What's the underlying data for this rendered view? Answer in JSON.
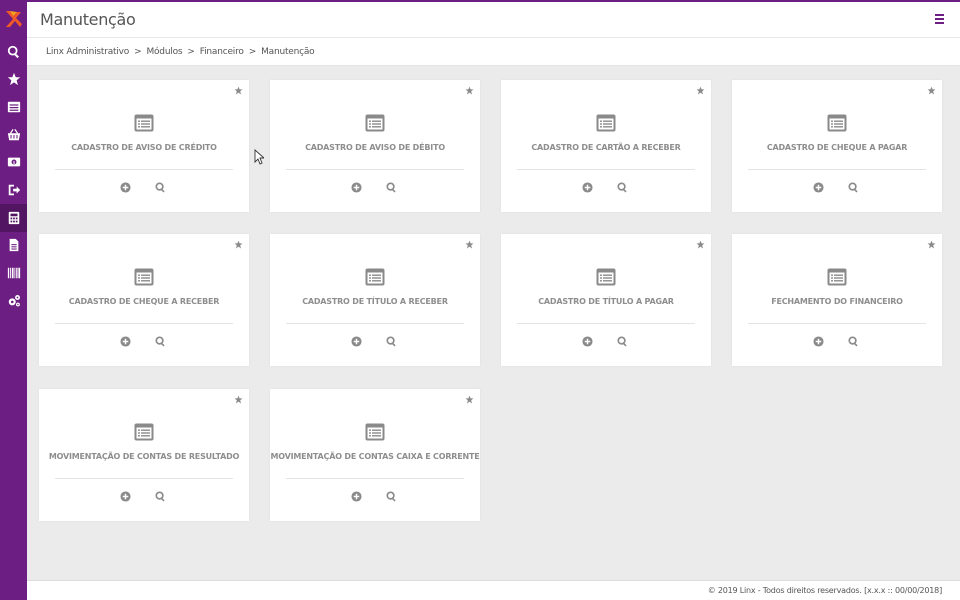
{
  "header": {
    "title": "Manutenção",
    "menu_icon": "hamburger-icon"
  },
  "breadcrumb": [
    {
      "label": "Linx Administrativo"
    },
    {
      "label": "Módulos"
    },
    {
      "label": "Financeiro"
    },
    {
      "label": "Manutenção"
    }
  ],
  "breadcrumb_separator": ">",
  "sidebar": {
    "logo": "linx-logo",
    "items": [
      {
        "icon": "search-icon"
      },
      {
        "icon": "star-icon"
      },
      {
        "icon": "list-icon"
      },
      {
        "icon": "basket-icon"
      },
      {
        "icon": "money-icon"
      },
      {
        "icon": "sign-out-icon"
      },
      {
        "icon": "calculator-icon",
        "active": true
      },
      {
        "icon": "document-icon"
      },
      {
        "icon": "barcode-icon"
      },
      {
        "icon": "gears-icon"
      }
    ]
  },
  "cards": [
    {
      "title": "CADASTRO DE AVISO DE CRÉDITO"
    },
    {
      "title": "CADASTRO DE AVISO DE DÉBITO"
    },
    {
      "title": "CADASTRO DE CARTÃO A RECEBER"
    },
    {
      "title": "CADASTRO DE CHEQUE A PAGAR"
    },
    {
      "title": "CADASTRO DE CHEQUE A RECEBER"
    },
    {
      "title": "CADASTRO DE TÍTULO A RECEBER"
    },
    {
      "title": "CADASTRO DE TÍTULO A PAGAR"
    },
    {
      "title": "FECHAMENTO DO FINANCEIRO"
    },
    {
      "title": "MOVIMENTAÇÃO DE CONTAS DE RESULTADO"
    },
    {
      "title": "MOVIMENTAÇÃO DE CONTAS CAIXA E CORRENTE"
    }
  ],
  "footer": {
    "text": "© 2019 Linx - Todos direitos reservados. [x.x.x :: 00/00/2018]"
  },
  "colors": {
    "brand": "#6d1e82",
    "brand_dark": "#521561",
    "icon_gray": "#8a8a8a",
    "page_bg": "#ebebeb"
  }
}
